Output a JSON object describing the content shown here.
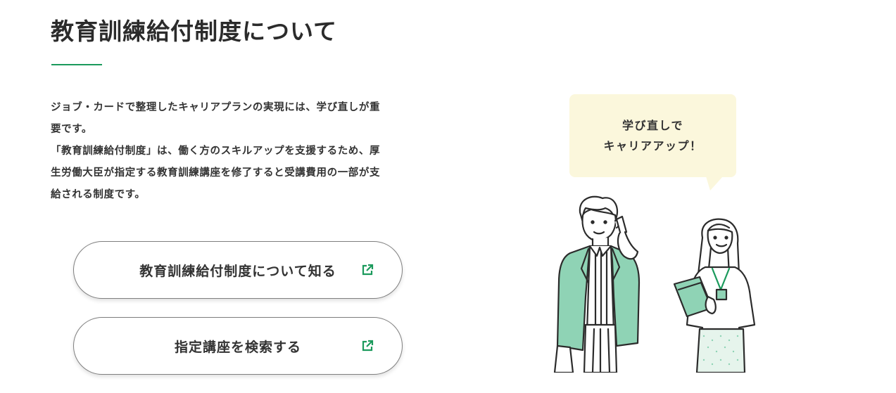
{
  "section": {
    "title": "教育訓練給付制度について"
  },
  "intro": {
    "text": "ジョブ・カードで整理したキャリアプランの実現には、学び直しが重\n要です。\n「教育訓練給付制度」は、働く方のスキルアップを支援するため、厚\n生労働大臣が指定する教育訓練講座を修了すると受講費用の一部が支\n給される制度です。"
  },
  "buttons": [
    {
      "label": "教育訓練給付制度について知る",
      "icon": "external-link-icon"
    },
    {
      "label": "指定講座を検索する",
      "icon": "external-link-icon"
    }
  ],
  "bubble": {
    "line1": "学び直しで",
    "line2": "キャリアアップ！"
  },
  "colors": {
    "accent": "#1b9a5c",
    "bubble_bg": "#fbf7dc",
    "jacket": "#8fd3b5",
    "text": "#333333"
  }
}
